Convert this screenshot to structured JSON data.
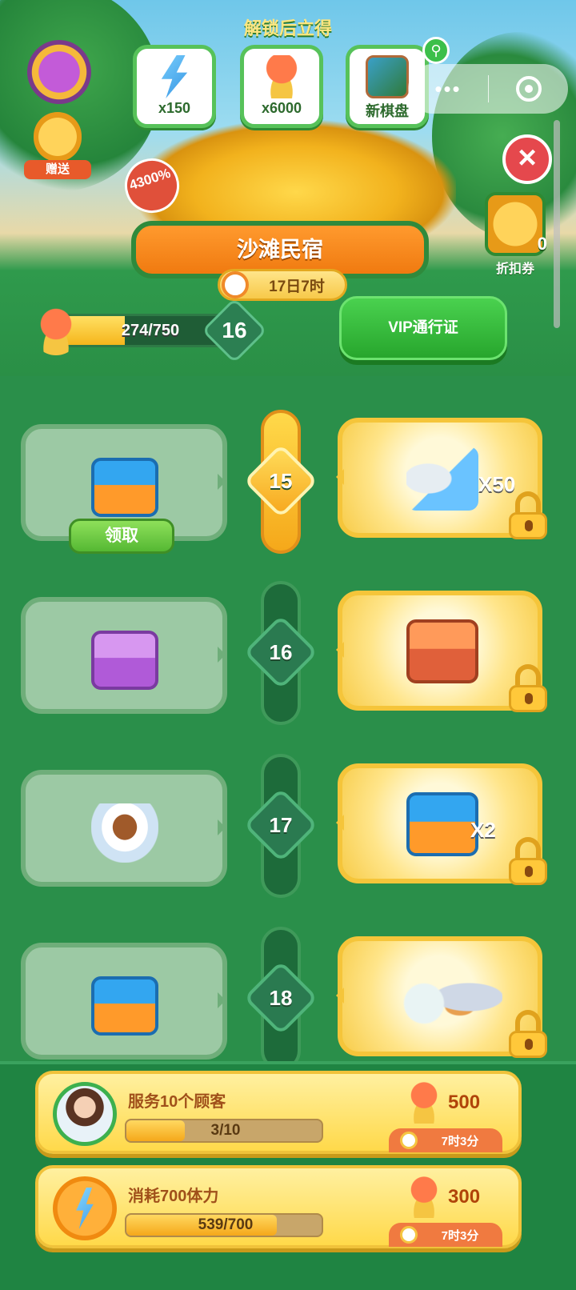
{
  "header": {
    "unlock_title": "解锁后立得",
    "unlock_rewards": [
      {
        "icon": "energy-bolt-icon",
        "label": "x150"
      },
      {
        "icon": "beach-umbrella-icon",
        "label": "x6000"
      },
      {
        "icon": "new-board-icon",
        "label": "新棋盘"
      }
    ],
    "gift_label": "赠送",
    "discount_count": "0",
    "discount_label": "折扣券",
    "percent_badge": "4300%",
    "event_name": "沙滩民宿",
    "event_timer": "17日7时"
  },
  "progress": {
    "current": 274,
    "target": 750,
    "text": "274/750",
    "level": "16",
    "vip_button": "VIP通行证"
  },
  "track": [
    {
      "level": "15",
      "active": true,
      "free_item": "blue-chest-icon",
      "claim_label": "领取",
      "vip_item": "bowl-and-energy-icon",
      "vip_qty": "X50"
    },
    {
      "level": "16",
      "active": false,
      "free_item": "purple-chest-icon",
      "vip_item": "treasure-chest-icon",
      "vip_qty": ""
    },
    {
      "level": "17",
      "active": false,
      "free_item": "tea-cup-icon",
      "vip_item": "blue-chest-icon",
      "vip_qty": "X2"
    },
    {
      "level": "18",
      "active": false,
      "free_item": "blue-chest-icon",
      "vip_item": "food-set-icon",
      "vip_qty": ""
    }
  ],
  "tasks": [
    {
      "title": "服务10个顾客",
      "progress_text": "3/10",
      "progress": 0.3,
      "reward": "500",
      "time": "7时3分",
      "icon": "customer-avatar-icon"
    },
    {
      "title": "消耗700体力",
      "progress_text": "539/700",
      "progress": 0.77,
      "reward": "300",
      "time": "7时3分",
      "icon": "energy-bolt-icon"
    }
  ],
  "colors": {
    "background": "#1f8a45",
    "active_gold": "#f5b51b",
    "vip_green": "#27a62d"
  }
}
